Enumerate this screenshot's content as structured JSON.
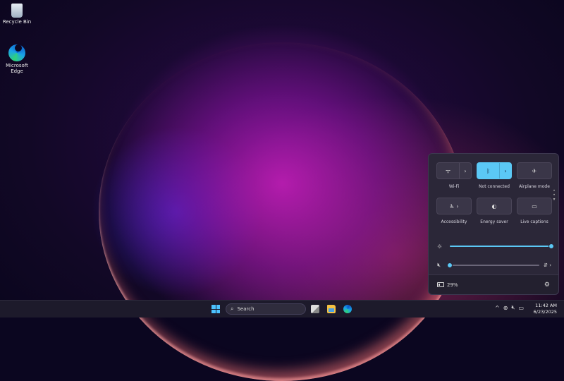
{
  "desktop": {
    "icons": [
      {
        "label": "Recycle Bin",
        "icon": "recycle-bin-icon"
      },
      {
        "label": "Microsoft Edge",
        "icon": "edge-icon"
      }
    ]
  },
  "quick_settings": {
    "tiles": [
      {
        "label": "Wi-Fi",
        "icon": "wifi-icon",
        "state": "off",
        "has_arrow": true
      },
      {
        "label": "Not connected",
        "icon": "bluetooth-icon",
        "state": "on",
        "has_arrow": true
      },
      {
        "label": "Airplane mode",
        "icon": "airplane-icon",
        "state": "off",
        "has_arrow": false
      },
      {
        "label": "Accessibility",
        "icon": "accessibility-icon",
        "state": "off",
        "has_arrow": true
      },
      {
        "label": "Energy saver",
        "icon": "energy-saver-icon",
        "state": "off",
        "has_arrow": false
      },
      {
        "label": "Live captions",
        "icon": "live-captions-icon",
        "state": "off",
        "has_arrow": false
      }
    ],
    "brightness": {
      "icon": "brightness-icon",
      "level": 1.0
    },
    "volume": {
      "icon": "speaker-muted-icon",
      "level": 0.0,
      "end": "⇵ ›"
    },
    "battery": {
      "text": "29%",
      "icon": "battery-icon"
    },
    "settings_icon": "gear-icon"
  },
  "taskbar": {
    "search_placeholder": "Search",
    "clock": {
      "time": "11:42 AM",
      "date": "6/23/2025"
    },
    "tray_chevron": "^"
  },
  "colors": {
    "accent": "#5bc8f5",
    "panel": "#2b2738",
    "taskbar": "#1d1a2b"
  }
}
